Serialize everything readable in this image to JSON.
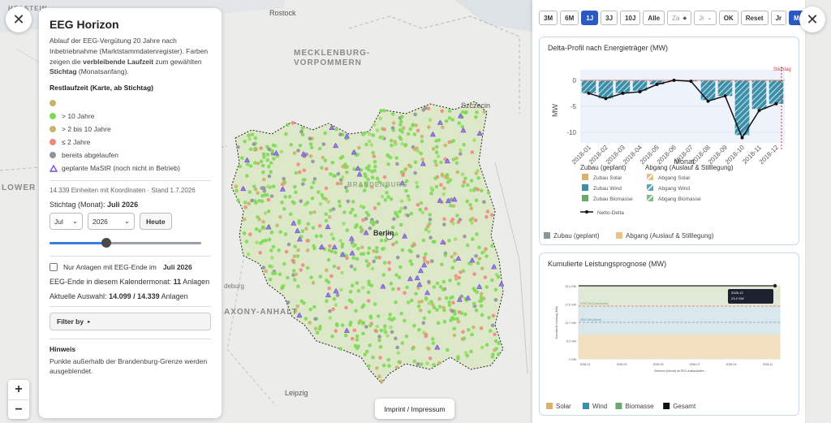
{
  "map": {
    "labels": {
      "mecklenburg": "MECKLENBURG-",
      "vorpommern": "VORPOMMERN",
      "holstein": "HOLSTEIN",
      "lower_saxony": "LOWER SA",
      "saxony_anhalt": "AXONY-ANHALT"
    },
    "cities": {
      "rostock": "Rostock",
      "szczecin": "Szczecin",
      "berlin": "Berlin",
      "magdeburg": "deburg",
      "leipzig": "Leipzig",
      "potsdam": "BRANDENBURG"
    }
  },
  "left_panel": {
    "title": "EEG Horizon",
    "desc1": "Ablauf der EEG-Vergütung 20 Jahre nach Inbetriebnahme (Marktstammdatenregister). Farben zeigen die ",
    "desc_b1": "verbleibende Laufzeit",
    "desc2": " zum gewählten ",
    "desc_b2": "Stichtag",
    "desc3": " (Monatsanfang).",
    "legend_title": "Restlaufzeit (Karte, ab Stichtag)",
    "legend": [
      {
        "label": "",
        "color": "#c8b46a"
      },
      {
        "label": "> 10 Jahre",
        "color": "#7ed957"
      },
      {
        "label": "> 2 bis 10 Jahre",
        "color": "#c8b46a"
      },
      {
        "label": "≤ 2 Jahre",
        "color": "#ef8a80"
      },
      {
        "label": "bereits abgelaufen",
        "color": "#8e949c"
      }
    ],
    "planned_label": "geplante MaStR (noch nicht in Betrieb)",
    "meta": "14.339 Einheiten mit Koordinaten · Stand 1.7.2026",
    "stichtag_label": "Stichtag (Monat):",
    "stichtag_value": "Juli 2026",
    "month_select": "Jul",
    "year_select": "2026",
    "heute_button": "Heute",
    "slider_pct": 35,
    "checkbox_label": "Nur Anlagen mit EEG-Ende im",
    "checkbox_value": "Juli 2026",
    "eeg_end_label": "EEG-Ende in diesem Kalendermonat:",
    "eeg_end_value": "11",
    "eeg_end_unit": "Anlagen",
    "selection_label": "Aktuelle Auswahl:",
    "selection_value": "14.099 / 14.339",
    "selection_unit": "Anlagen",
    "filter_button": "Filter by",
    "hint_title": "Hinweis",
    "hint_text": "Punkte außerhalb der Brandenburg-Grenze werden ausgeblendet."
  },
  "imprint": "Imprint / Impressum",
  "toolbar": {
    "buttons": [
      "3M",
      "6M",
      "1J",
      "3J",
      "10J",
      "Alle"
    ],
    "active": "1J",
    "date_from": "Za",
    "date_unit": "Jr",
    "ok": "OK",
    "reset": "Reset",
    "gran": [
      "Jr",
      "Mo"
    ],
    "gran_active": "Mo",
    "cut": "12"
  },
  "delta_chart": {
    "title": "Delta-Profil nach Energieträger (MW)",
    "ylabel": "MW",
    "xlabel": "Monat",
    "marker": "Stichtag",
    "legend_left_title": "Zubau (geplant)",
    "legend_right_title": "Abgang (Auslauf & Stilllegung)",
    "legend_left": [
      "Zubau Solar",
      "Zubau Wind",
      "Zubau Biomasse"
    ],
    "legend_right": [
      "Abgang Solar",
      "Abgang Wind",
      "Abgang Biomasse"
    ],
    "netto": "Netto-Delta",
    "footer": [
      "Zubau (geplant)",
      "Abgang (Auslauf & Stilllegung)"
    ]
  },
  "cum_chart": {
    "title": "Kumulierte Leistungsprognose (MW)",
    "tooltip_date": "2026-12",
    "tooltip_value": "23.4 GW",
    "y_axis_label": "Kumulierte Leistung (MW)",
    "x_axis_label": "Zeitraum (Monat) ab EEG-Auslaufdaten",
    "band1": "2030 Ziel (Landesziel)",
    "band2": "2030 Ziel (Bund)",
    "footer": [
      "Solar",
      "Wind",
      "Biomasse",
      "Gesamt"
    ]
  },
  "chart_data": [
    {
      "type": "bar",
      "title": "Delta-Profil nach Energieträger (MW)",
      "xlabel": "Monat",
      "ylabel": "MW",
      "categories": [
        "2018-01",
        "2018-02",
        "2018-03",
        "2018-04",
        "2018-05",
        "2018-06",
        "2018-07",
        "2018-08",
        "2018-09",
        "2018-10",
        "2018-11",
        "2018-12"
      ],
      "ylim": [
        -12,
        2
      ],
      "yticks": [
        0,
        -5,
        -10
      ],
      "series": [
        {
          "name": "Abgang Wind",
          "values": [
            -2.5,
            -3.5,
            -2.5,
            -2.0,
            -0.8,
            0,
            -0.2,
            -3.8,
            -3.0,
            -10.5,
            -5.5,
            -4.5
          ]
        },
        {
          "name": "Netto-Delta",
          "values": [
            -2.5,
            -3.5,
            -2.5,
            -2.2,
            -0.8,
            0,
            -0.2,
            -4.0,
            -3.0,
            -11.0,
            -5.8,
            -4.5
          ]
        }
      ]
    },
    {
      "type": "area",
      "title": "Kumulierte Leistungsprognose (MW)",
      "categories": [
        "2026-01",
        "2026-03",
        "2026-05",
        "2026-07",
        "2026-09",
        "2026-11"
      ],
      "yticks": [
        "23.4 GW",
        "17.6 GW",
        "11.7 GW",
        "5.9 GW",
        "0 GW"
      ],
      "series": [
        {
          "name": "Solar",
          "values": [
            8.5,
            8.5,
            8.5,
            8.5,
            8.5,
            8.5
          ]
        },
        {
          "name": "Wind",
          "values": [
            7.0,
            7.0,
            7.0,
            7.0,
            7.0,
            7.0
          ]
        },
        {
          "name": "Biomasse",
          "values": [
            0.3,
            0.3,
            0.3,
            0.3,
            0.3,
            0.3
          ]
        },
        {
          "name": "Gesamt",
          "values": [
            23.4,
            23.4,
            23.4,
            23.4,
            23.4,
            23.4
          ]
        }
      ]
    }
  ]
}
